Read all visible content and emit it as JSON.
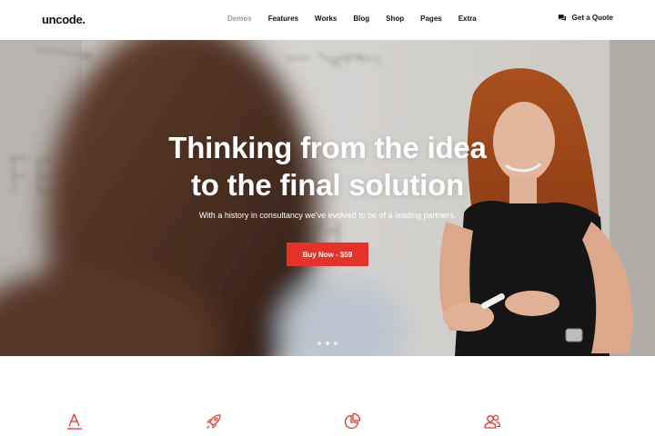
{
  "header": {
    "logo": "uncode.",
    "nav": [
      {
        "label": "Demos",
        "active": true
      },
      {
        "label": "Features",
        "active": false
      },
      {
        "label": "Works",
        "active": false
      },
      {
        "label": "Blog",
        "active": false
      },
      {
        "label": "Shop",
        "active": false
      },
      {
        "label": "Pages",
        "active": false
      },
      {
        "label": "Extra",
        "active": false
      }
    ],
    "quote_label": "Get a Quote",
    "quote_icon": "chat-bubbles-icon"
  },
  "hero": {
    "title_line1": "Thinking from the idea",
    "title_line2": "to the final solution",
    "subtitle": "With a history in consultancy we've evolved to be of a leading partners.",
    "cta_label": "Buy Now - $59",
    "slides_total": 3,
    "slide_active": 2
  },
  "features": {
    "icons": [
      "typography-icon",
      "rocket-icon",
      "pie-chart-icon",
      "users-icon"
    ]
  },
  "colors": {
    "accent": "#e6332a",
    "text": "#111111",
    "nav_active": "#9a9a9a"
  }
}
